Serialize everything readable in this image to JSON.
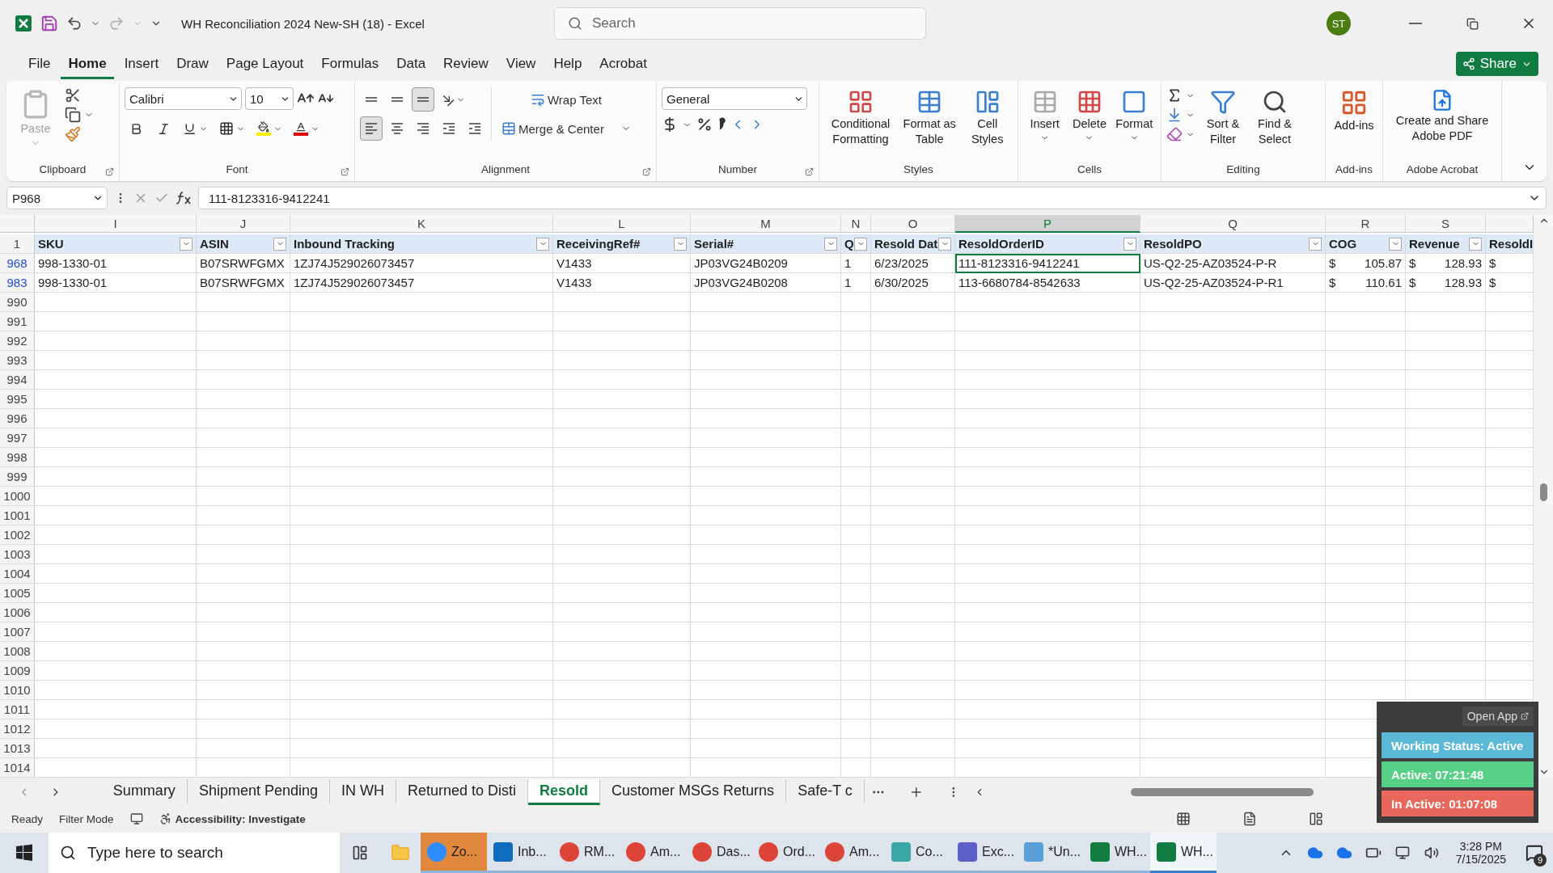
{
  "titlebar": {
    "title": "WH Reconciliation 2024 New-SH (18)  -  Excel",
    "search_placeholder": "Search",
    "avatar": "ST"
  },
  "menu": [
    {
      "label": "File",
      "selected": false
    },
    {
      "label": "Home",
      "selected": true
    },
    {
      "label": "Insert",
      "selected": false
    },
    {
      "label": "Draw",
      "selected": false
    },
    {
      "label": "Page Layout",
      "selected": false
    },
    {
      "label": "Formulas",
      "selected": false
    },
    {
      "label": "Data",
      "selected": false
    },
    {
      "label": "Review",
      "selected": false
    },
    {
      "label": "View",
      "selected": false
    },
    {
      "label": "Help",
      "selected": false
    },
    {
      "label": "Acrobat",
      "selected": false
    }
  ],
  "share": "Share",
  "ribbon": {
    "clipboard": {
      "label": "Clipboard",
      "paste": "Paste",
      "paste_disabled": true
    },
    "font": {
      "label": "Font",
      "font_name": "Calibri",
      "font_size": "10"
    },
    "alignment": {
      "label": "Alignment",
      "vertical": [
        {
          "selected": false
        },
        {
          "selected": false
        },
        {
          "selected": true
        }
      ],
      "horizontal": [
        {
          "selected": true
        },
        {
          "selected": false
        },
        {
          "selected": false
        }
      ],
      "wrap_text": "Wrap Text",
      "merge": "Merge & Center"
    },
    "number": {
      "label": "Number",
      "format": "General"
    },
    "styles": {
      "label": "Styles",
      "buttons": [
        "Conditional Formatting",
        "Format as Table",
        "Cell Styles"
      ]
    },
    "cells": {
      "label": "Cells",
      "buttons": [
        "Insert",
        "Delete",
        "Format"
      ]
    },
    "editing": {
      "label": "Editing",
      "buttons": [
        "Sort & Filter",
        "Find & Select"
      ]
    },
    "addins": {
      "label": "Add-ins",
      "buttons": [
        "Add-ins"
      ]
    },
    "acrobat": {
      "label": "Adobe Acrobat",
      "buttons": [
        "Create and Share Adobe PDF"
      ]
    }
  },
  "formula_bar": {
    "name_box": "P968",
    "formula": "111-8123316-9412241"
  },
  "columns": [
    {
      "letter": "I",
      "selected": false
    },
    {
      "letter": "J",
      "selected": false
    },
    {
      "letter": "K",
      "selected": false
    },
    {
      "letter": "L",
      "selected": false
    },
    {
      "letter": "M",
      "selected": false
    },
    {
      "letter": "N",
      "selected": false
    },
    {
      "letter": "O",
      "selected": false
    },
    {
      "letter": "P",
      "selected": true
    },
    {
      "letter": "Q",
      "selected": false
    },
    {
      "letter": "R",
      "selected": false
    },
    {
      "letter": "S",
      "selected": false
    }
  ],
  "header_row": {
    "number": "1",
    "cells": [
      {
        "text": "SKU",
        "filter": true
      },
      {
        "text": "ASIN",
        "filter": true
      },
      {
        "text": "Inbound Tracking",
        "filter": true
      },
      {
        "text": "ReceivingRef#",
        "filter": true
      },
      {
        "text": "Serial#",
        "filter": true
      },
      {
        "text": "Q",
        "filter": true
      },
      {
        "text": "Resold Dat",
        "filter": true
      },
      {
        "text": "ResoldOrderID",
        "filter": true
      },
      {
        "text": "ResoldPO",
        "filter": true
      },
      {
        "text": "COG",
        "filter": true
      },
      {
        "text": "Revenue",
        "filter": true
      },
      {
        "text": "ResoldI"
      }
    ]
  },
  "rows": [
    {
      "number": "968",
      "filtered": true,
      "cells": [
        {
          "text": "998-1330-01",
          "selected": false
        },
        {
          "text": "B07SRWFGMX",
          "selected": false
        },
        {
          "text": "1ZJ74J529026073457",
          "selected": false
        },
        {
          "text": "V1433",
          "selected": false
        },
        {
          "text": "JP03VG24B0209",
          "selected": false
        },
        {
          "text": "1",
          "selected": false
        },
        {
          "text": "6/23/2025",
          "selected": false
        },
        {
          "text": "111-8123316-9412241",
          "selected": true
        },
        {
          "text": "US-Q2-25-AZ03524-P-R",
          "selected": false
        },
        {
          "currency": "$",
          "text": "105.87",
          "selected": false
        },
        {
          "currency": "$",
          "text": "128.93",
          "selected": false
        },
        {
          "currency": "$",
          "selected": false
        }
      ]
    },
    {
      "number": "983",
      "filtered": true,
      "cells": [
        {
          "text": "998-1330-01",
          "selected": false
        },
        {
          "text": "B07SRWFGMX",
          "selected": false
        },
        {
          "text": "1ZJ74J529026073457",
          "selected": false
        },
        {
          "text": "V1433",
          "selected": false
        },
        {
          "text": "JP03VG24B0208",
          "selected": false
        },
        {
          "text": "1",
          "selected": false
        },
        {
          "text": "6/30/2025",
          "selected": false
        },
        {
          "text": "113-6680784-8542633",
          "selected": false
        },
        {
          "text": "US-Q2-25-AZ03524-P-R1",
          "selected": false
        },
        {
          "currency": "$",
          "text": "110.61",
          "selected": false
        },
        {
          "currency": "$",
          "text": "128.93",
          "selected": false
        },
        {
          "currency": "$",
          "selected": false
        }
      ]
    },
    {
      "number": "990",
      "filtered": false
    },
    {
      "number": "991",
      "filtered": false
    },
    {
      "number": "992",
      "filtered": false
    },
    {
      "number": "993",
      "filtered": false
    },
    {
      "number": "994",
      "filtered": false
    },
    {
      "number": "995",
      "filtered": false
    },
    {
      "number": "996",
      "filtered": false
    },
    {
      "number": "997",
      "filtered": false
    },
    {
      "number": "998",
      "filtered": false
    },
    {
      "number": "999",
      "filtered": false
    },
    {
      "number": "1000",
      "filtered": false
    },
    {
      "number": "1001",
      "filtered": false
    },
    {
      "number": "1002",
      "filtered": false
    },
    {
      "number": "1003",
      "filtered": false
    },
    {
      "number": "1004",
      "filtered": false
    },
    {
      "number": "1005",
      "filtered": false
    },
    {
      "number": "1006",
      "filtered": false
    },
    {
      "number": "1007",
      "filtered": false
    },
    {
      "number": "1008",
      "filtered": false
    },
    {
      "number": "1009",
      "filtered": false
    },
    {
      "number": "1010",
      "filtered": false
    },
    {
      "number": "1011",
      "filtered": false
    },
    {
      "number": "1012",
      "filtered": false
    },
    {
      "number": "1013",
      "filtered": false
    },
    {
      "number": "1014",
      "filtered": false
    }
  ],
  "sheet_tabs": [
    {
      "label": "Summary",
      "selected": false
    },
    {
      "label": "Shipment Pending",
      "selected": false
    },
    {
      "label": "IN WH",
      "selected": false
    },
    {
      "label": "Returned to Disti",
      "selected": false
    },
    {
      "label": "Resold",
      "selected": true
    },
    {
      "label": "Customer MSGs Returns",
      "selected": false
    },
    {
      "label": "Safe-T c",
      "selected": false
    }
  ],
  "status_bar": {
    "mode": "Ready",
    "filter": "Filter Mode",
    "accessibility": "Accessibility: Investigate"
  },
  "tracker": {
    "open_app": "Open App",
    "items": [
      {
        "text": "Working Status: Active",
        "color": "#5bb8d6"
      },
      {
        "text": "Active: 07:21:48",
        "color": "#58cf86"
      },
      {
        "text": "In Active: 01:07:08",
        "color": "#e8695c"
      }
    ]
  },
  "taskbar": {
    "search_placeholder": "Type here to search",
    "apps": [
      {
        "label": "Zo...",
        "color": "#2d8cff",
        "attention": true,
        "active": false
      },
      {
        "label": "Inb...",
        "color": "#0f6cbd",
        "attention": false,
        "active": false
      },
      {
        "label": "RM...",
        "color": "#db4437",
        "attention": false,
        "active": false
      },
      {
        "label": "Am...",
        "color": "#db4437",
        "attention": false,
        "active": false
      },
      {
        "label": "Das...",
        "color": "#db4437",
        "attention": false,
        "active": false
      },
      {
        "label": "Ord...",
        "color": "#db4437",
        "attention": false,
        "active": false
      },
      {
        "label": "Am...",
        "color": "#db4437",
        "attention": false,
        "active": false
      },
      {
        "label": "Co...",
        "color": "#3aa6a6",
        "attention": false,
        "active": false
      },
      {
        "label": "Exc...",
        "color": "#5b5fc7",
        "attention": false,
        "active": false
      },
      {
        "label": "*Un...",
        "color": "#5aa0d8",
        "attention": false,
        "active": false
      },
      {
        "label": "WH...",
        "color": "#107c41",
        "attention": false,
        "active": false
      },
      {
        "label": "WH...",
        "color": "#107c41",
        "attention": false,
        "active": true
      }
    ],
    "time": "3:28 PM",
    "date": "7/15/2025",
    "notifications": "9"
  }
}
